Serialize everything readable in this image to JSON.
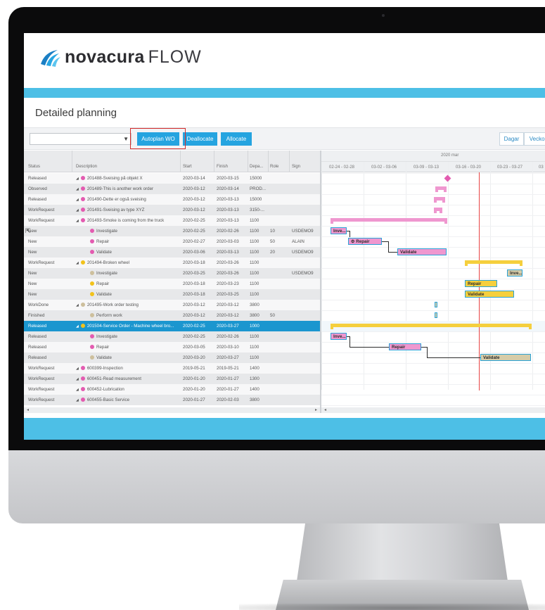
{
  "brand": {
    "name_bold": "novacura",
    "name_light": "FLOW"
  },
  "page": {
    "title": "Detailed planning"
  },
  "toolbar": {
    "select_value": "",
    "autoplan_label": "Autoplan WO",
    "deallocate_label": "Deallocate",
    "allocate_label": "Allocate",
    "view_day_label": "Dagar",
    "view_week_label": "Veckor"
  },
  "grid": {
    "headers": {
      "status": "Status",
      "description": "Description",
      "start": "Start",
      "finish": "Finish",
      "department": "Depa...",
      "role": "Role",
      "sign": "Sign"
    },
    "rows": [
      {
        "status": "Released",
        "description": "201488-Sveising på objekt X",
        "start": "2020-03-14",
        "finish": "2020-03-15",
        "dep": "15000",
        "role": "",
        "sign": "",
        "level": 0,
        "color": "#e35bb0"
      },
      {
        "status": "Observed",
        "description": "201489-This is another work order",
        "start": "2020-03-12",
        "finish": "2020-03-14",
        "dep": "PROD...",
        "role": "",
        "sign": "",
        "level": 0,
        "color": "#e35bb0"
      },
      {
        "status": "Released",
        "description": "201490-Dette er også sveising",
        "start": "2020-03-12",
        "finish": "2020-03-13",
        "dep": "15000",
        "role": "",
        "sign": "",
        "level": 0,
        "color": "#e35bb0"
      },
      {
        "status": "WorkRequest",
        "description": "201491-Sveising av type XYZ",
        "start": "2020-03-12",
        "finish": "2020-03-13",
        "dep": "3150-...",
        "role": "",
        "sign": "",
        "level": 0,
        "color": "#e35bb0"
      },
      {
        "status": "WorkRequest",
        "description": "201493-Smoke is coming from the truck",
        "start": "2020-02-25",
        "finish": "2020-03-13",
        "dep": "1100",
        "role": "",
        "sign": "",
        "level": 0,
        "color": "#e35bb0"
      },
      {
        "status": "New",
        "description": "Investigate",
        "start": "2020-02-25",
        "finish": "2020-02-26",
        "dep": "1100",
        "role": "10",
        "sign": "USDEMO9",
        "level": 1,
        "color": "#e35bb0"
      },
      {
        "status": "New",
        "description": "Repair",
        "start": "2020-02-27",
        "finish": "2020-03-03",
        "dep": "1100",
        "role": "50",
        "sign": "ALAIN",
        "level": 1,
        "color": "#e35bb0"
      },
      {
        "status": "New",
        "description": "Validate",
        "start": "2020-03-06",
        "finish": "2020-03-13",
        "dep": "1100",
        "role": "20",
        "sign": "USDEMO9",
        "level": 1,
        "color": "#e35bb0"
      },
      {
        "status": "WorkRequest",
        "description": "201494-Broken wheel",
        "start": "2020-03-18",
        "finish": "2020-03-26",
        "dep": "1100",
        "role": "",
        "sign": "",
        "level": 0,
        "color": "#f2c21b"
      },
      {
        "status": "New",
        "description": "Investigate",
        "start": "2020-03-25",
        "finish": "2020-03-26",
        "dep": "1100",
        "role": "",
        "sign": "USDEMO9",
        "level": 1,
        "color": "#cdbf9c"
      },
      {
        "status": "New",
        "description": "Repair",
        "start": "2020-03-18",
        "finish": "2020-03-23",
        "dep": "1100",
        "role": "",
        "sign": "",
        "level": 1,
        "color": "#f2c21b"
      },
      {
        "status": "New",
        "description": "Validate",
        "start": "2020-03-18",
        "finish": "2020-03-25",
        "dep": "1100",
        "role": "",
        "sign": "",
        "level": 1,
        "color": "#f2c21b"
      },
      {
        "status": "WorkDone",
        "description": "201495-Work order testing",
        "start": "2020-03-12",
        "finish": "2020-03-12",
        "dep": "3800",
        "role": "",
        "sign": "",
        "level": 0,
        "color": "#cdbf9c"
      },
      {
        "status": "Finished",
        "description": "Perform work",
        "start": "2020-03-12",
        "finish": "2020-03-12",
        "dep": "3800",
        "role": "50",
        "sign": "",
        "level": 1,
        "color": "#cdbf9c"
      },
      {
        "status": "Released",
        "description": "201504-Service Order - Machine wheel bro...",
        "start": "2020-02-25",
        "finish": "2020-03-27",
        "dep": "1000",
        "role": "",
        "sign": "",
        "level": 0,
        "color": "#f2c21b",
        "selected": true
      },
      {
        "status": "Released",
        "description": "Investigate",
        "start": "2020-02-25",
        "finish": "2020-02-26",
        "dep": "1100",
        "role": "",
        "sign": "",
        "level": 1,
        "color": "#e35bb0"
      },
      {
        "status": "Released",
        "description": "Repair",
        "start": "2020-03-05",
        "finish": "2020-03-10",
        "dep": "1100",
        "role": "",
        "sign": "",
        "level": 1,
        "color": "#e35bb0"
      },
      {
        "status": "Released",
        "description": "Validate",
        "start": "2020-03-20",
        "finish": "2020-03-27",
        "dep": "1100",
        "role": "",
        "sign": "",
        "level": 1,
        "color": "#cdbf9c"
      },
      {
        "status": "WorkRequest",
        "description": "600399-Inspection",
        "start": "2019-05-21",
        "finish": "2019-05-21",
        "dep": "1400",
        "role": "",
        "sign": "",
        "level": 0,
        "color": "#e35bb0"
      },
      {
        "status": "WorkRequest",
        "description": "600451-Read measurement",
        "start": "2020-01-20",
        "finish": "2020-01-27",
        "dep": "1300",
        "role": "",
        "sign": "",
        "level": 0,
        "color": "#e35bb0"
      },
      {
        "status": "WorkRequest",
        "description": "600452-Lubrication",
        "start": "2020-01-20",
        "finish": "2020-01-27",
        "dep": "1400",
        "role": "",
        "sign": "",
        "level": 0,
        "color": "#e35bb0"
      },
      {
        "status": "WorkRequest",
        "description": "600455-Basic Service",
        "start": "2020-01-27",
        "finish": "2020-02-03",
        "dep": "3800",
        "role": "",
        "sign": "",
        "level": 0,
        "color": "#e35bb0"
      }
    ]
  },
  "gantt": {
    "month_label": "2020 mar",
    "weeks": [
      "02-24 - 02-28",
      "03-02 - 03-06",
      "03-09 - 03-13",
      "03-16 - 03-20",
      "03-23 - 03-27",
      "03"
    ],
    "bar_labels": {
      "inv1": "Inve...",
      "repair1": "Repair",
      "validate1": "Validate",
      "inv2": "Inve...",
      "repair2": "Repair",
      "validate2": "Validate",
      "inv3": "Inve...",
      "repair3": "Repair",
      "validate3": "Validate"
    },
    "colors": {
      "pink": "#ef97cf",
      "pink_dark": "#e35bb0",
      "yellow": "#f5cf3d",
      "tan": "#d6cca8",
      "bar_border": "#2aa3d8",
      "today": "#e84545"
    }
  }
}
